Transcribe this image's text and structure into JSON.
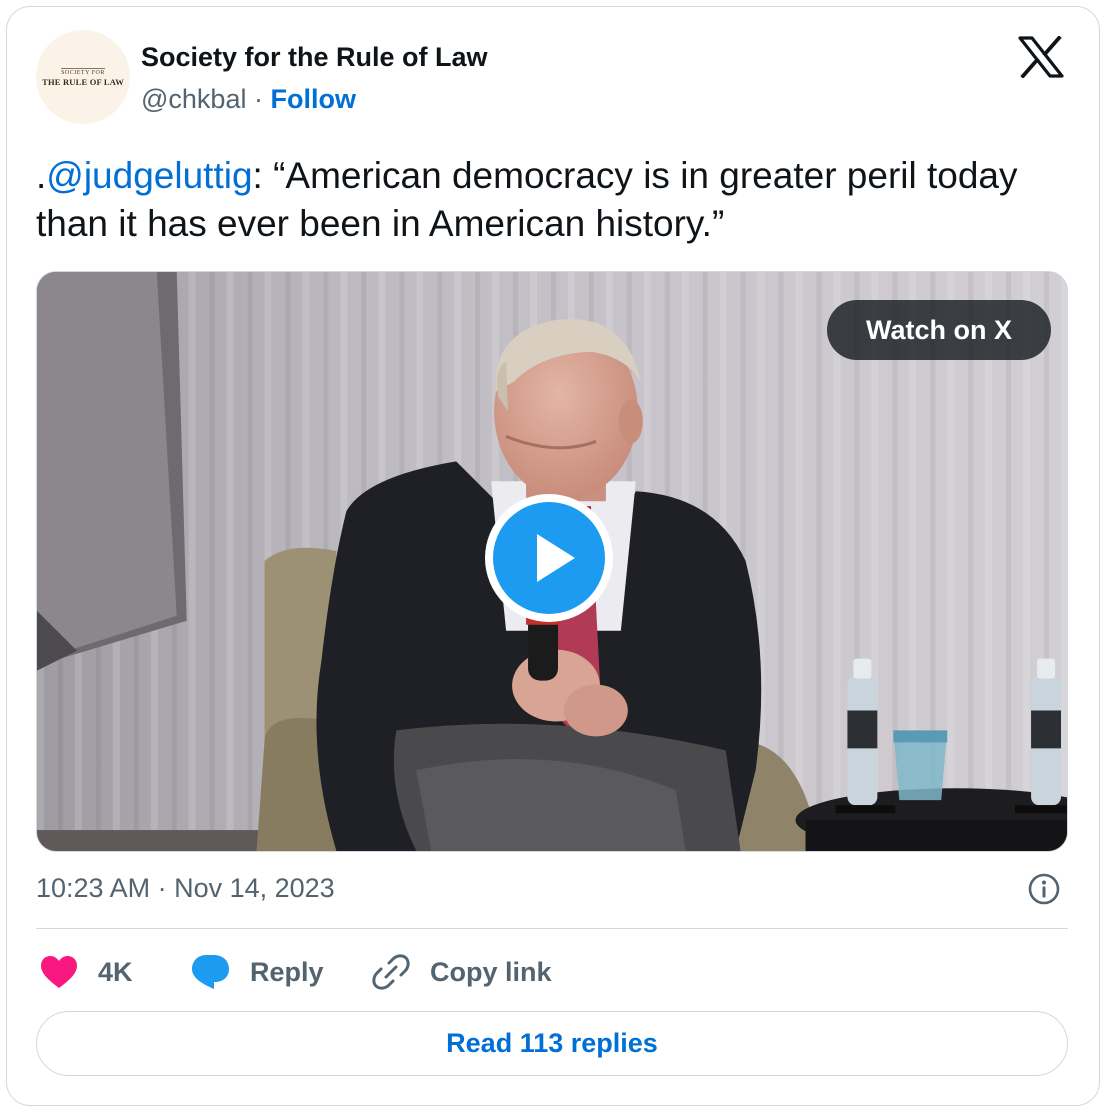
{
  "author": {
    "avatar_line1": "Society for",
    "avatar_line2": "The Rule of Law",
    "name": "Society for the Rule of Law",
    "handle": "@chkbal",
    "separator": " · ",
    "follow_label": "Follow"
  },
  "tweet": {
    "prefix": ".",
    "mention": "@judgeluttig",
    "text_after_mention": ": “American democracy is in greater peril today than it has ever been in American history.”"
  },
  "media": {
    "watch_label": "Watch on X"
  },
  "meta": {
    "timestamp": "10:23 AM · Nov 14, 2023"
  },
  "actions": {
    "like_count": "4K",
    "reply_label": "Reply",
    "copy_link_label": "Copy link"
  },
  "footer": {
    "read_replies_label": "Read 113 replies"
  },
  "colors": {
    "link": "#006fd6",
    "play": "#1d9bf0",
    "heart": "#f91880",
    "secondary_text": "#536471",
    "border": "#cfd9de"
  }
}
